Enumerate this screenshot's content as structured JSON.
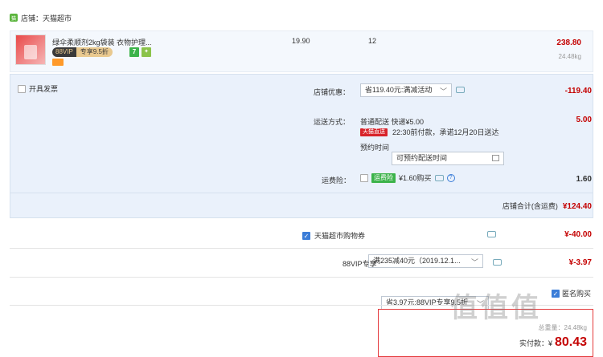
{
  "store": {
    "name": "店铺：天猫超市",
    "icon": "tmall-store-icon"
  },
  "item": {
    "title": "绿伞柔顺剂2kg袋装 衣物护理...",
    "vip_tag_a": "88VIP",
    "vip_tag_b": "专享9.5折",
    "seven": "7",
    "price": "19.90",
    "qty": "12",
    "subtotal": "238.80",
    "weight": "24.48kg"
  },
  "invoice": {
    "label": "开具发票"
  },
  "store_discount": {
    "label": "店铺优惠：",
    "value": "省119.40元:满减活动",
    "amount": "-119.40"
  },
  "shipping": {
    "label": "运送方式：",
    "method": "普通配送 快递¥5.00",
    "tmzs": "天猫直送",
    "promise": "22:30前付款，承诺12月20日送达",
    "reserve_label": "预约时间",
    "reserve_value": "可预约配送时间",
    "amount": "5.00"
  },
  "insurance": {
    "label": "运费险：",
    "tag": "运费险",
    "price": "¥1.60购买",
    "amount": "1.60"
  },
  "store_total": {
    "label": "店铺合计(含运费)",
    "amount": "¥124.40"
  },
  "coupon": {
    "label": "天猫超市购物券",
    "value": "满235减40元（2019.12.1...",
    "amount": "¥-40.00"
  },
  "vip_discount": {
    "label": "88VIP专享",
    "value": "省3.97元:88VIP专享9.5折",
    "amount": "¥-3.97"
  },
  "footer": {
    "anon_label": "匿名购买",
    "weight": "总重量：24.48kg",
    "pay_label": "实付款：¥",
    "pay_amount": "80.43"
  },
  "watermark": "值值值"
}
